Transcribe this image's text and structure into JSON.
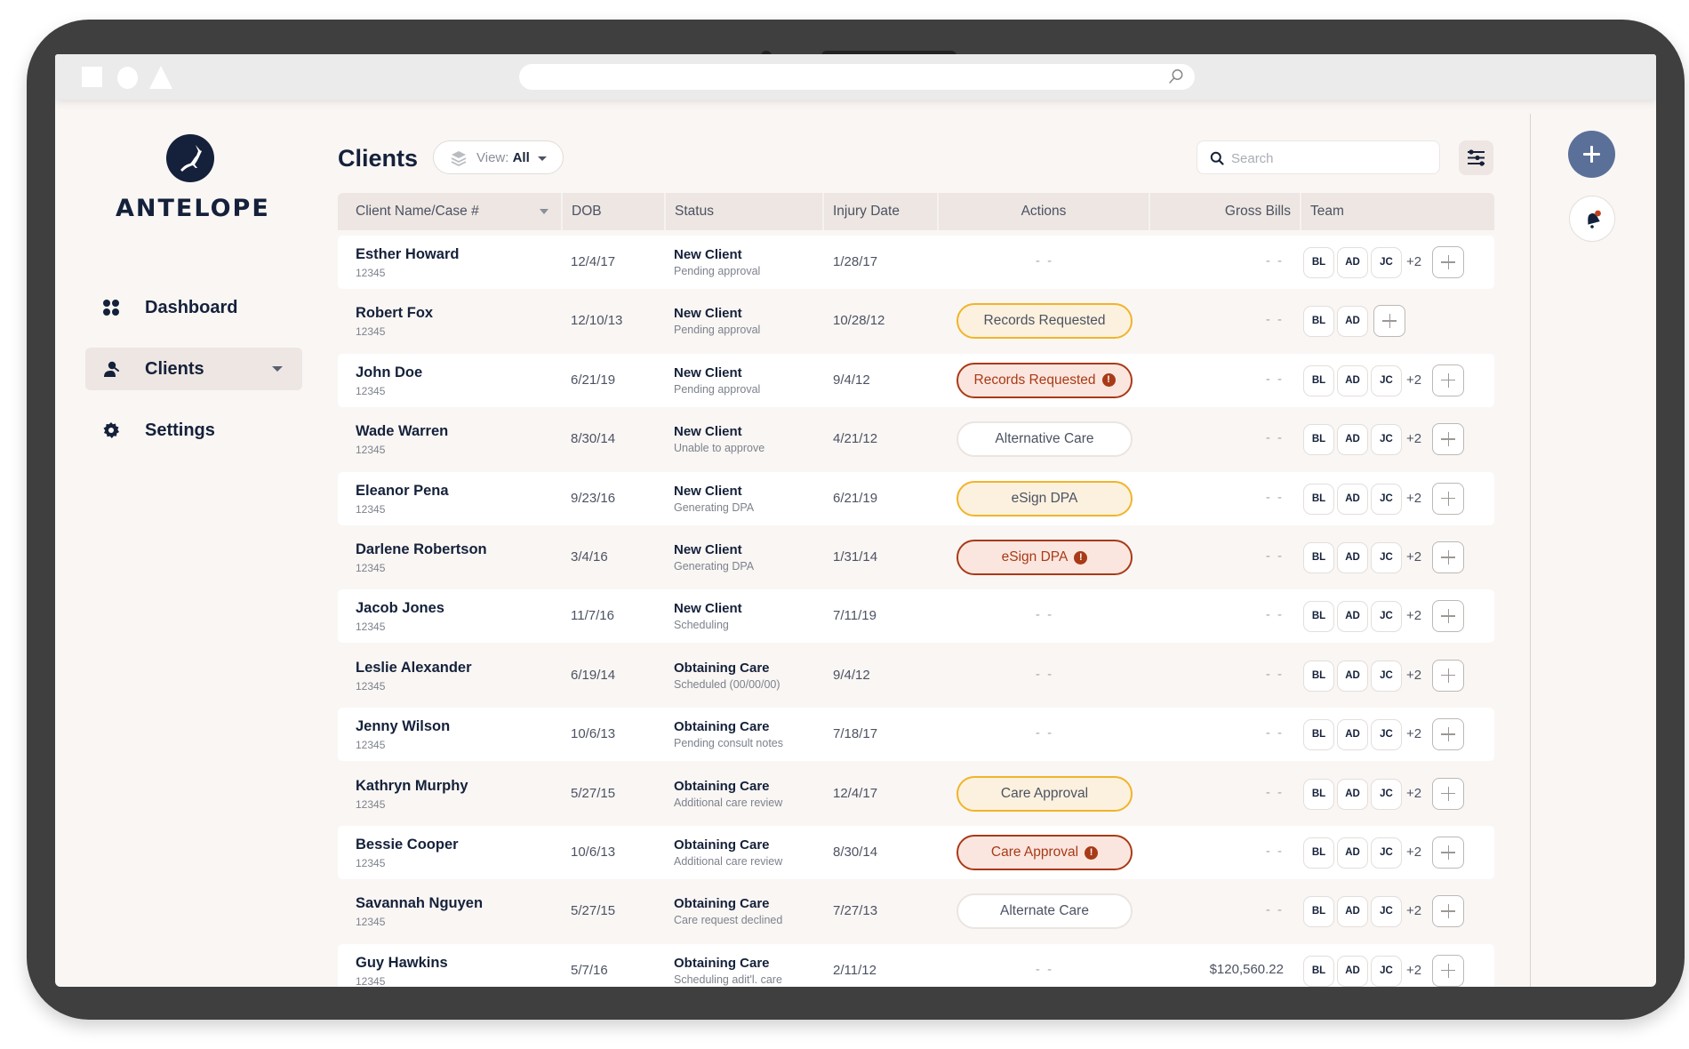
{
  "app": {
    "brand": "ANTELOPE"
  },
  "sidebar": {
    "items": [
      {
        "label": "Dashboard",
        "icon": "dashboard-grid-icon",
        "active": false
      },
      {
        "label": "Clients",
        "icon": "clients-person-icon",
        "active": true
      },
      {
        "label": "Settings",
        "icon": "settings-gear-icon",
        "active": false
      }
    ]
  },
  "header": {
    "title": "Clients",
    "view_label": "View:",
    "view_value": "All",
    "search_placeholder": "Search",
    "search_value": ""
  },
  "table": {
    "columns": [
      "Client Name/Case #",
      "DOB",
      "Status",
      "Injury Date",
      "Actions",
      "Gross Bills",
      "Team"
    ],
    "rows": [
      {
        "name": "Esther Howard",
        "case": "12345",
        "dob": "12/4/17",
        "status": "New Client",
        "substatus": "Pending approval",
        "injury": "1/28/17",
        "action": null,
        "action_style": null,
        "action_alert": false,
        "gross": "- -",
        "team": [
          "BL",
          "AD",
          "JC"
        ],
        "team_more": "+2"
      },
      {
        "name": "Robert Fox",
        "case": "12345",
        "dob": "12/10/13",
        "status": "New Client",
        "substatus": "Pending approval",
        "injury": "10/28/12",
        "action": "Records Requested",
        "action_style": "yellow",
        "action_alert": false,
        "gross": "- -",
        "team": [
          "BL",
          "AD"
        ],
        "team_more": null
      },
      {
        "name": "John Doe",
        "case": "12345",
        "dob": "6/21/19",
        "status": "New Client",
        "substatus": "Pending approval",
        "injury": "9/4/12",
        "action": "Records Requested",
        "action_style": "red",
        "action_alert": true,
        "gross": "- -",
        "team": [
          "BL",
          "AD",
          "JC"
        ],
        "team_more": "+2"
      },
      {
        "name": "Wade Warren",
        "case": "12345",
        "dob": "8/30/14",
        "status": "New Client",
        "substatus": "Unable to approve",
        "injury": "4/21/12",
        "action": "Alternative Care",
        "action_style": "neutral",
        "action_alert": false,
        "gross": "- -",
        "team": [
          "BL",
          "AD",
          "JC"
        ],
        "team_more": "+2"
      },
      {
        "name": "Eleanor Pena",
        "case": "12345",
        "dob": "9/23/16",
        "status": "New Client",
        "substatus": "Generating DPA",
        "injury": "6/21/19",
        "action": "eSign DPA",
        "action_style": "yellow",
        "action_alert": false,
        "gross": "- -",
        "team": [
          "BL",
          "AD",
          "JC"
        ],
        "team_more": "+2"
      },
      {
        "name": "Darlene Robertson",
        "case": "12345",
        "dob": "3/4/16",
        "status": "New Client",
        "substatus": "Generating DPA",
        "injury": "1/31/14",
        "action": "eSign DPA",
        "action_style": "red",
        "action_alert": true,
        "gross": "- -",
        "team": [
          "BL",
          "AD",
          "JC"
        ],
        "team_more": "+2"
      },
      {
        "name": "Jacob Jones",
        "case": "12345",
        "dob": "11/7/16",
        "status": "New Client",
        "substatus": "Scheduling",
        "injury": "7/11/19",
        "action": null,
        "action_style": null,
        "action_alert": false,
        "gross": "- -",
        "team": [
          "BL",
          "AD",
          "JC"
        ],
        "team_more": "+2"
      },
      {
        "name": "Leslie Alexander",
        "case": "12345",
        "dob": "6/19/14",
        "status": "Obtaining Care",
        "substatus": "Scheduled (00/00/00)",
        "injury": "9/4/12",
        "action": null,
        "action_style": null,
        "action_alert": false,
        "gross": "- -",
        "team": [
          "BL",
          "AD",
          "JC"
        ],
        "team_more": "+2"
      },
      {
        "name": "Jenny Wilson",
        "case": "12345",
        "dob": "10/6/13",
        "status": "Obtaining Care",
        "substatus": "Pending consult notes",
        "injury": "7/18/17",
        "action": null,
        "action_style": null,
        "action_alert": false,
        "gross": "- -",
        "team": [
          "BL",
          "AD",
          "JC"
        ],
        "team_more": "+2"
      },
      {
        "name": "Kathryn Murphy",
        "case": "12345",
        "dob": "5/27/15",
        "status": "Obtaining Care",
        "substatus": "Additional care review",
        "injury": "12/4/17",
        "action": "Care Approval",
        "action_style": "yellow",
        "action_alert": false,
        "gross": "- -",
        "team": [
          "BL",
          "AD",
          "JC"
        ],
        "team_more": "+2"
      },
      {
        "name": "Bessie Cooper",
        "case": "12345",
        "dob": "10/6/13",
        "status": "Obtaining Care",
        "substatus": "Additional care review",
        "injury": "8/30/14",
        "action": "Care Approval",
        "action_style": "red",
        "action_alert": true,
        "gross": "- -",
        "team": [
          "BL",
          "AD",
          "JC"
        ],
        "team_more": "+2"
      },
      {
        "name": "Savannah Nguyen",
        "case": "12345",
        "dob": "5/27/15",
        "status": "Obtaining Care",
        "substatus": "Care request declined",
        "injury": "7/27/13",
        "action": "Alternate Care",
        "action_style": "neutral",
        "action_alert": false,
        "gross": "- -",
        "team": [
          "BL",
          "AD",
          "JC"
        ],
        "team_more": "+2"
      },
      {
        "name": "Guy Hawkins",
        "case": "12345",
        "dob": "5/7/16",
        "status": "Obtaining Care",
        "substatus": "Scheduling adit'l. care",
        "injury": "2/11/12",
        "action": null,
        "action_style": null,
        "action_alert": false,
        "gross": "$120,560.22",
        "team": [
          "BL",
          "AD",
          "JC"
        ],
        "team_more": "+2"
      }
    ],
    "empty_placeholder": "- -",
    "alert_glyph": "!"
  },
  "colors": {
    "brand_navy": "#15213a",
    "accent_blue": "#5a7098",
    "warning_yellow": "#f1b429",
    "alert_red": "#a83a17",
    "background": "#f9f6f4"
  }
}
